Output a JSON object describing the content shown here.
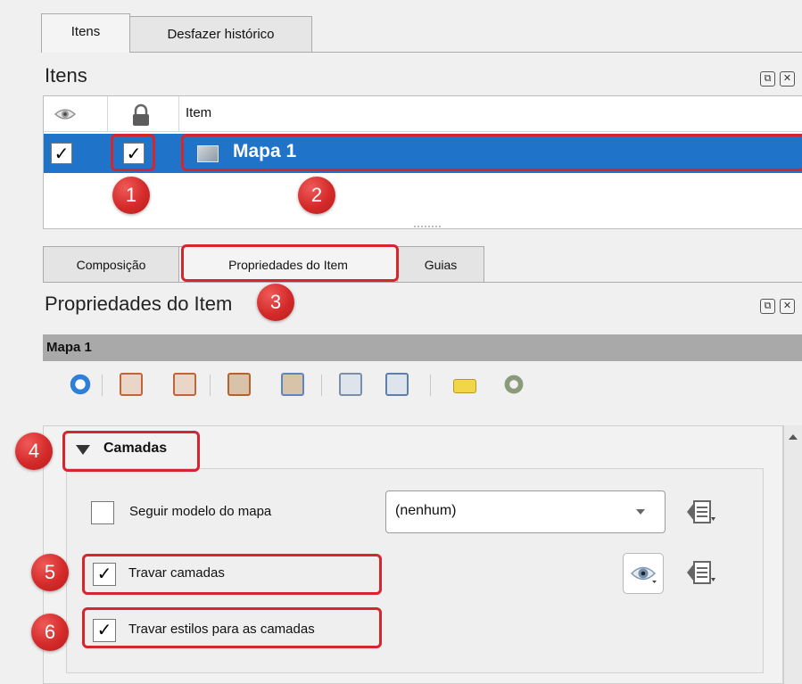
{
  "top_tabs": [
    {
      "label": "Itens",
      "active": true
    },
    {
      "label": "Desfazer histórico",
      "active": false
    }
  ],
  "items_panel": {
    "title": "Itens",
    "columns": {
      "visibility": "eye-icon",
      "lock": "lock-icon",
      "item": "Item"
    },
    "rows": [
      {
        "visible": "✓",
        "locked": "✓",
        "name": "Mapa 1",
        "selected": true
      }
    ]
  },
  "bottom_tabs": [
    {
      "label": "Composição"
    },
    {
      "label": "Propriedades do Item"
    },
    {
      "label": "Guias"
    }
  ],
  "properties_panel": {
    "title": "Propriedades do Item",
    "section_label": "Mapa 1"
  },
  "layers_group": {
    "title": "Camadas",
    "follow_theme": {
      "checked": false,
      "label": "Seguir modelo do mapa"
    },
    "theme_combo": {
      "value": "(nenhum)"
    },
    "lock_layers": {
      "checked": true,
      "check_mark": "✓",
      "label": "Travar camadas"
    },
    "lock_styles": {
      "checked": true,
      "check_mark": "✓",
      "label": "Travar estilos para as camadas"
    }
  },
  "annotations": [
    "1",
    "2",
    "3",
    "4",
    "5",
    "6"
  ],
  "colors": {
    "selection": "#1f73c9",
    "annotation": "#d4262c",
    "section_bar": "#a9a9a9"
  }
}
